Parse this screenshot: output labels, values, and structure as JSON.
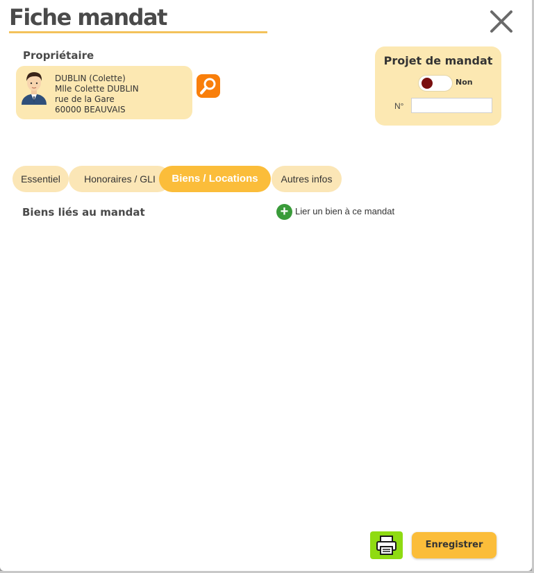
{
  "header": {
    "title": "Fiche mandat",
    "close_icon": "close-icon"
  },
  "owner": {
    "section_label": "Propriétaire",
    "name": "DUBLIN (Colette)",
    "full_name": "Mlle Colette DUBLIN",
    "street": "rue de la Gare",
    "city": "60000 BEAUVAIS",
    "search_icon": "search-icon"
  },
  "project": {
    "title": "Projet de mandat",
    "toggle_label": "Non",
    "number_label": "N°",
    "number_value": ""
  },
  "tabs": [
    {
      "label": "Essentiel",
      "active": false
    },
    {
      "label": "Honoraires / GLI",
      "active": false
    },
    {
      "label": "Biens / Locations",
      "active": true
    },
    {
      "label": "Autres infos",
      "active": false
    }
  ],
  "biens": {
    "heading": "Biens liés au mandat",
    "link_label": "Lier un bien à ce mandat",
    "link_icon": "plus-circle-icon"
  },
  "footer": {
    "print_icon": "printer-icon",
    "save_label": "Enregistrer"
  },
  "colors": {
    "accent": "#fbbd3a",
    "tab_bg": "#fbe6b6",
    "card_bg": "#fce8b2",
    "search_orange": "#f97f0b",
    "print_green": "#8fdb12",
    "link_green": "#3a9b3a"
  }
}
